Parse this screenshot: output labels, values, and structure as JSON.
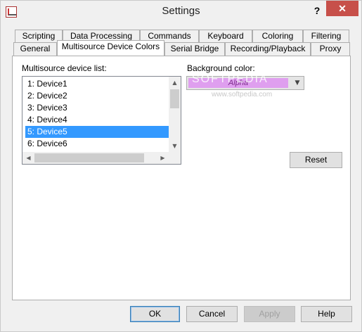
{
  "window": {
    "title": "Settings",
    "help_glyph": "?",
    "close_glyph": "✕"
  },
  "tabs": {
    "row_top": [
      "Scripting",
      "Data Processing",
      "Commands",
      "Keyboard",
      "Coloring",
      "Filtering"
    ],
    "row_bottom": [
      "General",
      "Multisource Device Colors",
      "Serial Bridge",
      "Recording/Playback",
      "Proxy"
    ],
    "active": "Multisource Device Colors"
  },
  "panel": {
    "device_list_label": "Multisource device list:",
    "devices": [
      "1: Device1",
      "2: Device2",
      "3: Device3",
      "4: Device4",
      "5: Device5",
      "6: Device6"
    ],
    "selected_device": "5: Device5",
    "background_color_label": "Background color:",
    "background_color_value": "Alpha",
    "background_color_swatch": "#df9fef",
    "reset_label": "Reset"
  },
  "footer": {
    "ok_label": "OK",
    "cancel_label": "Cancel",
    "apply_label": "Apply",
    "help_label": "Help"
  },
  "watermark": {
    "text": "SOFTPEDIA",
    "url": "www.softpedia.com"
  },
  "icons": {
    "app": "app-icon",
    "scroll_up": "chevron-up-icon",
    "scroll_down": "chevron-down-icon",
    "scroll_left": "chevron-left-icon",
    "scroll_right": "chevron-right-icon",
    "combo_arrow": "chevron-down-icon"
  }
}
